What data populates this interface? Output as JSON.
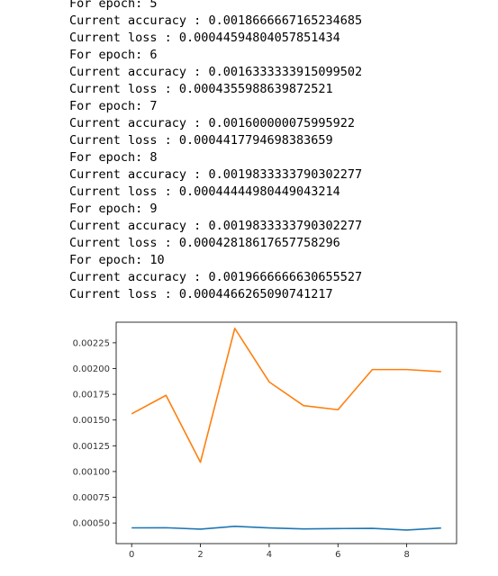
{
  "console_output": [
    {
      "label": "For epoch: ",
      "value": "5"
    },
    {
      "label": "Current accuracy : ",
      "value": "0.0018666667165234685"
    },
    {
      "label": "Current loss : ",
      "value": "0.00044594804057851434"
    },
    {
      "label": "For epoch: ",
      "value": "6"
    },
    {
      "label": "Current accuracy : ",
      "value": "0.0016333333915099502"
    },
    {
      "label": "Current loss : ",
      "value": "0.0004355988639872521"
    },
    {
      "label": "For epoch: ",
      "value": "7"
    },
    {
      "label": "Current accuracy : ",
      "value": "0.001600000075995922"
    },
    {
      "label": "Current loss : ",
      "value": "0.0004417794698383659"
    },
    {
      "label": "For epoch: ",
      "value": "8"
    },
    {
      "label": "Current accuracy : ",
      "value": "0.0019833333790302277"
    },
    {
      "label": "Current loss : ",
      "value": "0.00044444980449043214"
    },
    {
      "label": "For epoch: ",
      "value": "9"
    },
    {
      "label": "Current accuracy : ",
      "value": "0.0019833333790302277"
    },
    {
      "label": "Current loss : ",
      "value": "0.00042818617657758296"
    },
    {
      "label": "For epoch: ",
      "value": "10"
    },
    {
      "label": "Current accuracy : ",
      "value": "0.0019666666630655527"
    },
    {
      "label": "Current loss : ",
      "value": "0.0004466265090741217"
    }
  ],
  "chart_data": {
    "type": "line",
    "title": "",
    "xlabel": "",
    "ylabel": "",
    "x": [
      0,
      1,
      2,
      3,
      4,
      5,
      6,
      7,
      8,
      9
    ],
    "xlim": [
      -0.45,
      9.45
    ],
    "ylim": [
      0.0003,
      0.00245
    ],
    "x_ticks": [
      0,
      2,
      4,
      6,
      8
    ],
    "x_tick_labels": [
      "0",
      "2",
      "4",
      "6",
      "8"
    ],
    "y_ticks": [
      0.0005,
      0.00075,
      0.001,
      0.00125,
      0.0015,
      0.00175,
      0.002,
      0.00225
    ],
    "y_tick_labels": [
      "0.00050",
      "0.00075",
      "0.00100",
      "0.00125",
      "0.00150",
      "0.00175",
      "0.00200",
      "0.00225"
    ],
    "grid": false,
    "legend": false,
    "series": [
      {
        "color": "#1f77b4",
        "values": [
          0.000453,
          0.000454,
          0.00044,
          0.000468,
          0.000452,
          0.000443,
          0.000446,
          0.000448,
          0.000432,
          0.000451
        ]
      },
      {
        "color": "#ff7f0e",
        "values": [
          0.00156,
          0.00174,
          0.00109,
          0.00239,
          0.00187,
          0.00164,
          0.0016,
          0.00199,
          0.00199,
          0.00197
        ]
      }
    ]
  }
}
